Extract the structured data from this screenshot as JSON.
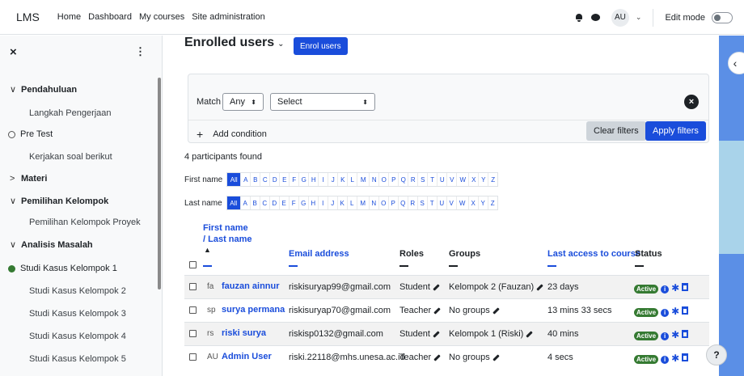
{
  "navbar": {
    "brand": "LMS",
    "links": [
      "Home",
      "Dashboard",
      "My courses",
      "Site administration"
    ],
    "avatar_initials": "AU",
    "edit_mode_label": "Edit mode"
  },
  "drawer": {
    "items": [
      {
        "type": "section",
        "caret": "∨",
        "label": "Pendahuluan"
      },
      {
        "type": "activity",
        "label": "Langkah Pengerjaan"
      },
      {
        "type": "mark-ring",
        "label": "Pre Test"
      },
      {
        "type": "activity",
        "label": "Kerjakan soal berikut"
      },
      {
        "type": "section",
        "caret": ">",
        "label": "Materi"
      },
      {
        "type": "section",
        "caret": "∨",
        "label": "Pemilihan Kelompok"
      },
      {
        "type": "activity",
        "label": "Pemilihan Kelompok Proyek"
      },
      {
        "type": "section",
        "caret": "∨",
        "label": "Analisis Masalah"
      },
      {
        "type": "mark-dot",
        "label": "Studi Kasus Kelompok 1"
      },
      {
        "type": "activity",
        "label": "Studi Kasus Kelompok 2"
      },
      {
        "type": "activity",
        "label": "Studi Kasus Kelompok 3"
      },
      {
        "type": "activity",
        "label": "Studi Kasus Kelompok 4"
      },
      {
        "type": "activity",
        "label": "Studi Kasus Kelompok 5"
      }
    ]
  },
  "page": {
    "title": "Enrolled users",
    "enrol_button": "Enrol users"
  },
  "filters": {
    "match_label": "Match",
    "match_value": "Any",
    "select_value": "Select",
    "add_condition": "Add condition",
    "clear_filters": "Clear filters",
    "apply_filters": "Apply filters"
  },
  "participants_found": "4 participants found",
  "alpha": {
    "first_name_label": "First name",
    "last_name_label": "Last name",
    "all": "All",
    "letters": [
      "A",
      "B",
      "C",
      "D",
      "E",
      "F",
      "G",
      "H",
      "I",
      "J",
      "K",
      "L",
      "M",
      "N",
      "O",
      "P",
      "Q",
      "R",
      "S",
      "T",
      "U",
      "V",
      "W",
      "X",
      "Y",
      "Z"
    ]
  },
  "table": {
    "headers": {
      "first_name": "First name",
      "last_name": "/ Last name",
      "email": "Email address",
      "roles": "Roles",
      "groups": "Groups",
      "last_access": "Last access to course",
      "status": "Status"
    },
    "rows": [
      {
        "initials": "fa",
        "name": "fauzan ainnur",
        "email": "riskisuryap99@gmail.com",
        "role": "Student",
        "group": "Kelompok 2 (Fauzan)",
        "last_access": "23 days",
        "status": "Active"
      },
      {
        "initials": "sp",
        "name": "surya permana",
        "email": "riskisuryap70@gmail.com",
        "role": "Teacher",
        "group": "No groups",
        "last_access": "13 mins 33 secs",
        "status": "Active"
      },
      {
        "initials": "rs",
        "name": "riski surya",
        "email": "riskisp0132@gmail.com",
        "role": "Student",
        "group": "Kelompok 1 (Riski)",
        "last_access": "40 mins",
        "status": "Active"
      },
      {
        "initials": "AU",
        "name": "Admin User",
        "email": "riski.22118@mhs.unesa.ac.id",
        "role": "Teacher",
        "group": "No groups",
        "last_access": "4 secs",
        "status": "Active"
      }
    ]
  },
  "help_button": "?",
  "colors": {
    "primary": "#1a4ddb",
    "success": "#357a32",
    "right_edge": "#5b8fe6"
  }
}
